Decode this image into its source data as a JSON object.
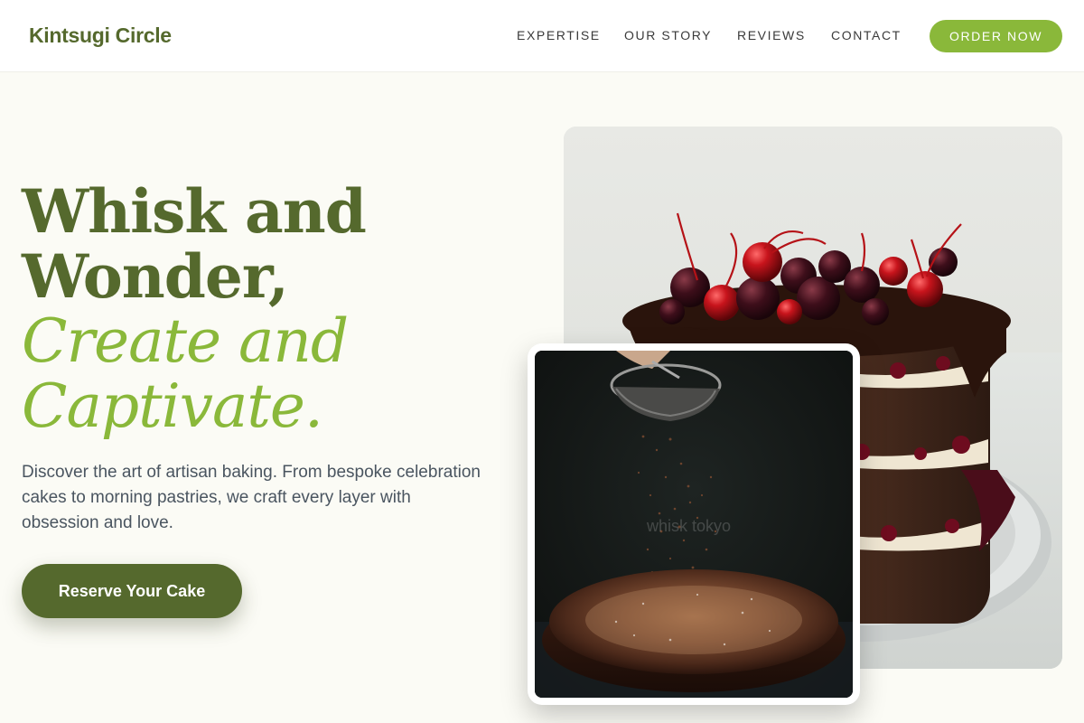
{
  "brand": "Kintsugi Circle",
  "nav": {
    "links": [
      "EXPERTISE",
      "OUR STORY",
      "REVIEWS",
      "CONTACT"
    ],
    "cta": "ORDER NOW"
  },
  "hero": {
    "headline_line1": "Whisk and",
    "headline_line2": "Wonder,",
    "headline_accent_line1": "Create and",
    "headline_accent_line2": "Captivate.",
    "lead": "Discover the art of artisan baking. From bespoke celebration cakes to morning pastries, we craft every layer with obsession and love.",
    "cta": "Reserve Your Cake"
  },
  "images": {
    "main": "black-forest-cake-photo",
    "secondary": "cocoa-dusted-cake-photo",
    "secondary_watermark": "whisk tokyo"
  },
  "colors": {
    "brand_dark": "#55692d",
    "brand_accent": "#8ab83a",
    "background": "#fbfbf5",
    "body_text": "#4a5560"
  }
}
